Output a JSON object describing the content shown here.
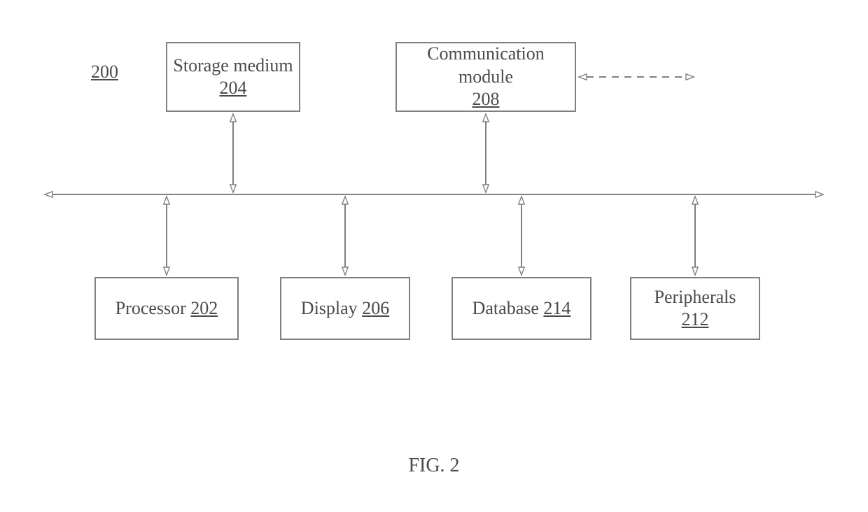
{
  "figure": {
    "ref": "200",
    "caption": "FIG. 2",
    "blocks": {
      "storage": {
        "label": "Storage medium",
        "num": "204"
      },
      "comm": {
        "label": "Communication module",
        "num": "208"
      },
      "processor": {
        "label": "Processor",
        "num": "202"
      },
      "display": {
        "label": "Display",
        "num": "206"
      },
      "database": {
        "label": "Database",
        "num": "214"
      },
      "periph": {
        "label": "Peripherals",
        "num": "212"
      }
    }
  }
}
